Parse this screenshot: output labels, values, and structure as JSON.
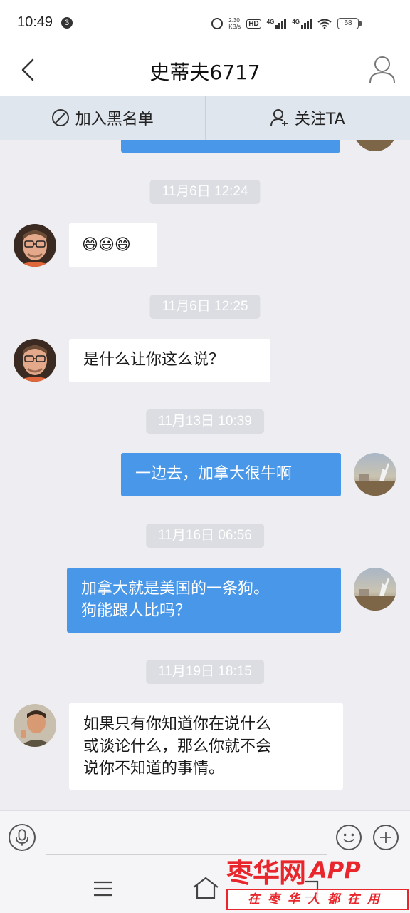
{
  "status_bar": {
    "time": "10:49",
    "notification_count": "3",
    "net_speed_value": "2.30",
    "net_speed_unit": "KB/s",
    "hd_label": "HD",
    "net1_label": "4G",
    "net2_label": "4G",
    "battery": "68",
    "icons": [
      "alarm-icon",
      "hd-icon",
      "signal-icon",
      "signal-icon",
      "wifi-icon",
      "battery-icon"
    ]
  },
  "header": {
    "title": "史蒂夫6717",
    "icons": [
      "back-chevron-icon",
      "profile-icon"
    ]
  },
  "actions": {
    "blacklist_label": "加入黑名单",
    "follow_label": "关注TA",
    "icons": [
      "ban-icon",
      "add-user-icon"
    ]
  },
  "messages": [
    {
      "type": "time",
      "text": "11月6日 12:24"
    },
    {
      "type": "in",
      "avatar": "avatar-steve",
      "emoji": [
        "😄",
        "😃",
        "😄"
      ]
    },
    {
      "type": "time",
      "text": "11月6日 12:25"
    },
    {
      "type": "in",
      "avatar": "avatar-steve",
      "lines": [
        "是什么让你这么说？"
      ]
    },
    {
      "type": "time",
      "text": "11月13日 10:39"
    },
    {
      "type": "out",
      "avatar": "avatar-me",
      "lines": [
        "一边去，加拿大很牛啊"
      ]
    },
    {
      "type": "time",
      "text": "11月16日 06:56"
    },
    {
      "type": "out",
      "avatar": "avatar-me",
      "lines": [
        "加拿大就是美国的一条狗。",
        "狗能跟人比吗？"
      ]
    },
    {
      "type": "time",
      "text": "11月19日 18:15"
    },
    {
      "type": "in",
      "avatar": "avatar-steve-2",
      "lines": [
        "如果只有你知道你在说什么",
        "或谈论什么，那么你就不会",
        "说你不知道的事情。"
      ]
    }
  ],
  "input_bar": {
    "icons": [
      "microphone-icon",
      "emoji-icon",
      "plus-icon"
    ]
  },
  "nav_bar": {
    "icons": [
      "menu-icon",
      "home-icon",
      "back-icon"
    ]
  },
  "watermark": {
    "name": "枣华网",
    "app": "APP",
    "slogan": "在枣华人都在用"
  },
  "colors": {
    "outgoing_bubble": "#4897e8",
    "incoming_bubble": "#ffffff",
    "chat_background": "#eeeef2",
    "action_bar": "#dfe6ee",
    "timestamp_pill": "#dcdde2",
    "watermark_red": "#e8262b"
  }
}
